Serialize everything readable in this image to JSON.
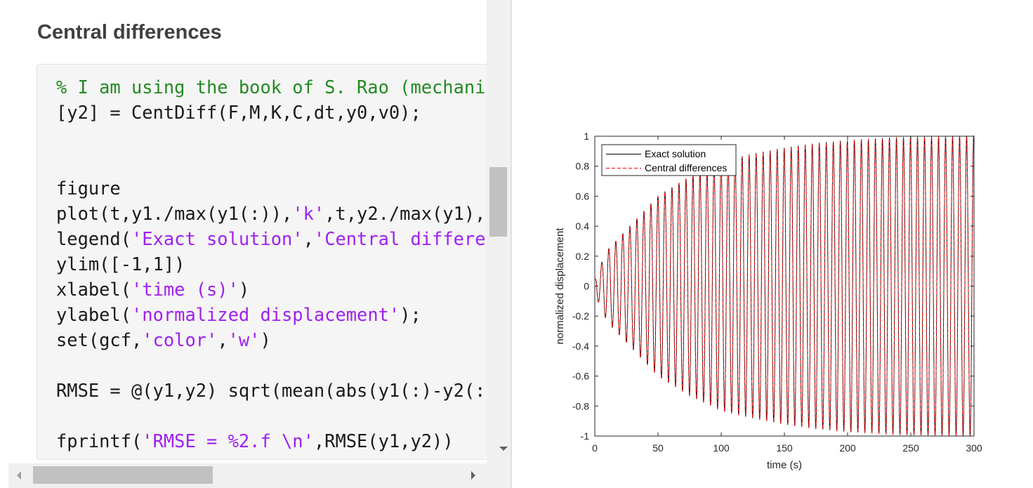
{
  "section_title": "Central differences",
  "code": {
    "lines": [
      [
        {
          "t": "% I am using the book of S. Rao (mechani",
          "c": "comment"
        }
      ],
      [
        {
          "t": "[y2] = CentDiff(F,M,K,C,dt,y0,v0);",
          "c": "plain"
        }
      ],
      [],
      [],
      [
        {
          "t": "figure",
          "c": "plain"
        }
      ],
      [
        {
          "t": "plot(t,y1./max(y1(:)),",
          "c": "plain"
        },
        {
          "t": "'k'",
          "c": "string"
        },
        {
          "t": ",t,y2./max(y1),",
          "c": "plain"
        }
      ],
      [
        {
          "t": "legend(",
          "c": "plain"
        },
        {
          "t": "'Exact solution'",
          "c": "string"
        },
        {
          "t": ",",
          "c": "plain"
        },
        {
          "t": "'Central differe",
          "c": "string"
        }
      ],
      [
        {
          "t": "ylim([-1,1])",
          "c": "plain"
        }
      ],
      [
        {
          "t": "xlabel(",
          "c": "plain"
        },
        {
          "t": "'time (s)'",
          "c": "string"
        },
        {
          "t": ")",
          "c": "plain"
        }
      ],
      [
        {
          "t": "ylabel(",
          "c": "plain"
        },
        {
          "t": "'normalized displacement'",
          "c": "string"
        },
        {
          "t": ");",
          "c": "plain"
        }
      ],
      [
        {
          "t": "set(gcf,",
          "c": "plain"
        },
        {
          "t": "'color'",
          "c": "string"
        },
        {
          "t": ",",
          "c": "plain"
        },
        {
          "t": "'w'",
          "c": "string"
        },
        {
          "t": ")",
          "c": "plain"
        }
      ],
      [],
      [
        {
          "t": "RMSE = @(y1,y2) sqrt(mean(abs(y1(:)-y2(:",
          "c": "plain"
        }
      ],
      [],
      [
        {
          "t": "fprintf(",
          "c": "plain"
        },
        {
          "t": "'RMSE = %2.f \\n'",
          "c": "string"
        },
        {
          "t": ",RMSE(y1,y2))",
          "c": "plain"
        }
      ]
    ]
  },
  "colors": {
    "comment": "#228b22",
    "string": "#a020f0",
    "code_text": "#1a1a1a",
    "exact_line": "#000000",
    "central_line": "#ff0000",
    "axes": "#262626"
  },
  "icons": {
    "scroll_down": "scroll-down-arrow-icon",
    "scroll_left": "scroll-left-arrow-icon",
    "scroll_right": "scroll-right-arrow-icon"
  },
  "chart_data": {
    "type": "line",
    "xlabel": "time (s)",
    "ylabel": "normalized displacement",
    "xlim": [
      0,
      300
    ],
    "ylim": [
      -1,
      1
    ],
    "xticks": [
      0,
      50,
      100,
      150,
      200,
      250,
      300
    ],
    "yticks": [
      -1,
      -0.8,
      -0.6,
      -0.4,
      -0.2,
      0,
      0.2,
      0.4,
      0.6,
      0.8,
      1
    ],
    "xtick_labels": [
      "0",
      "50",
      "100",
      "150",
      "200",
      "250",
      "300"
    ],
    "ytick_labels": [
      "-1",
      "-0.8",
      "-0.6",
      "-0.4",
      "-0.2",
      "0",
      "0.2",
      "0.4",
      "0.6",
      "0.8",
      "1"
    ],
    "legend_position": "top-left",
    "grid": false,
    "series": [
      {
        "name": "Exact solution",
        "style": "solid",
        "color": "#000000"
      },
      {
        "name": "Central differences",
        "style": "dashed",
        "color": "#ff0000"
      }
    ],
    "response": {
      "period_s": 5.55,
      "initial_value": 0.05,
      "envelope_t": [
        0,
        5,
        10,
        20,
        30,
        50,
        75,
        100,
        125,
        150,
        175,
        200,
        240,
        300
      ],
      "envelope_amp": [
        0.05,
        0.15,
        0.24,
        0.33,
        0.42,
        0.6,
        0.73,
        0.83,
        0.88,
        0.92,
        0.95,
        0.97,
        0.99,
        1.0
      ]
    }
  }
}
